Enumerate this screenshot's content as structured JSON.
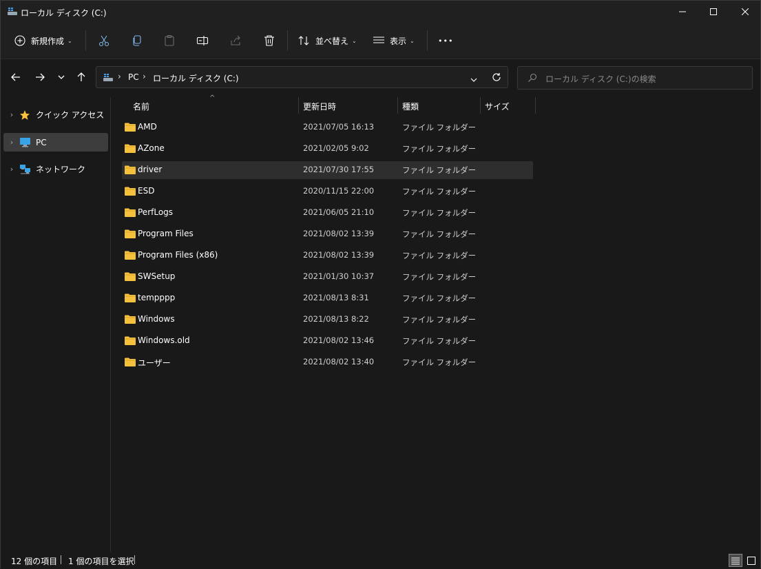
{
  "window": {
    "title": "ローカル ディスク (C:)"
  },
  "toolbar": {
    "new_label": "新規作成",
    "sort_label": "並べ替え",
    "view_label": "表示",
    "more_label": "•••"
  },
  "address": {
    "crumbs": [
      "PC",
      "ローカル ディスク (C:)"
    ],
    "search_placeholder": "ローカル ディスク (C:)の検索"
  },
  "sidebar": {
    "items": [
      {
        "label": "クイック アクセス",
        "icon": "star-icon"
      },
      {
        "label": "PC",
        "icon": "computer-icon"
      },
      {
        "label": "ネットワーク",
        "icon": "network-icon"
      }
    ]
  },
  "columns": {
    "name": "名前",
    "date": "更新日時",
    "type": "種類",
    "size": "サイズ"
  },
  "files": [
    {
      "name": "AMD",
      "date": "2021/07/05 16:13",
      "type": "ファイル フォルダー"
    },
    {
      "name": "AZone",
      "date": "2021/02/05 9:02",
      "type": "ファイル フォルダー"
    },
    {
      "name": "driver",
      "date": "2021/07/30 17:55",
      "type": "ファイル フォルダー"
    },
    {
      "name": "ESD",
      "date": "2020/11/15 22:00",
      "type": "ファイル フォルダー"
    },
    {
      "name": "PerfLogs",
      "date": "2021/06/05 21:10",
      "type": "ファイル フォルダー"
    },
    {
      "name": "Program Files",
      "date": "2021/08/02 13:39",
      "type": "ファイル フォルダー"
    },
    {
      "name": "Program Files (x86)",
      "date": "2021/08/02 13:39",
      "type": "ファイル フォルダー"
    },
    {
      "name": "SWSetup",
      "date": "2021/01/30 10:37",
      "type": "ファイル フォルダー"
    },
    {
      "name": "tempppp",
      "date": "2021/08/13 8:31",
      "type": "ファイル フォルダー"
    },
    {
      "name": "Windows",
      "date": "2021/08/13 8:22",
      "type": "ファイル フォルダー"
    },
    {
      "name": "Windows.old",
      "date": "2021/08/02 13:46",
      "type": "ファイル フォルダー"
    },
    {
      "name": "ユーザー",
      "date": "2021/08/02 13:40",
      "type": "ファイル フォルダー"
    }
  ],
  "selected_file": "driver",
  "status": {
    "count": "12 個の項目",
    "selection": "1 個の項目を選択"
  },
  "colors": {
    "background": "#191919",
    "chrome": "#202020",
    "folder": "#f4c13d",
    "selected_row": "#2e2e2e"
  }
}
